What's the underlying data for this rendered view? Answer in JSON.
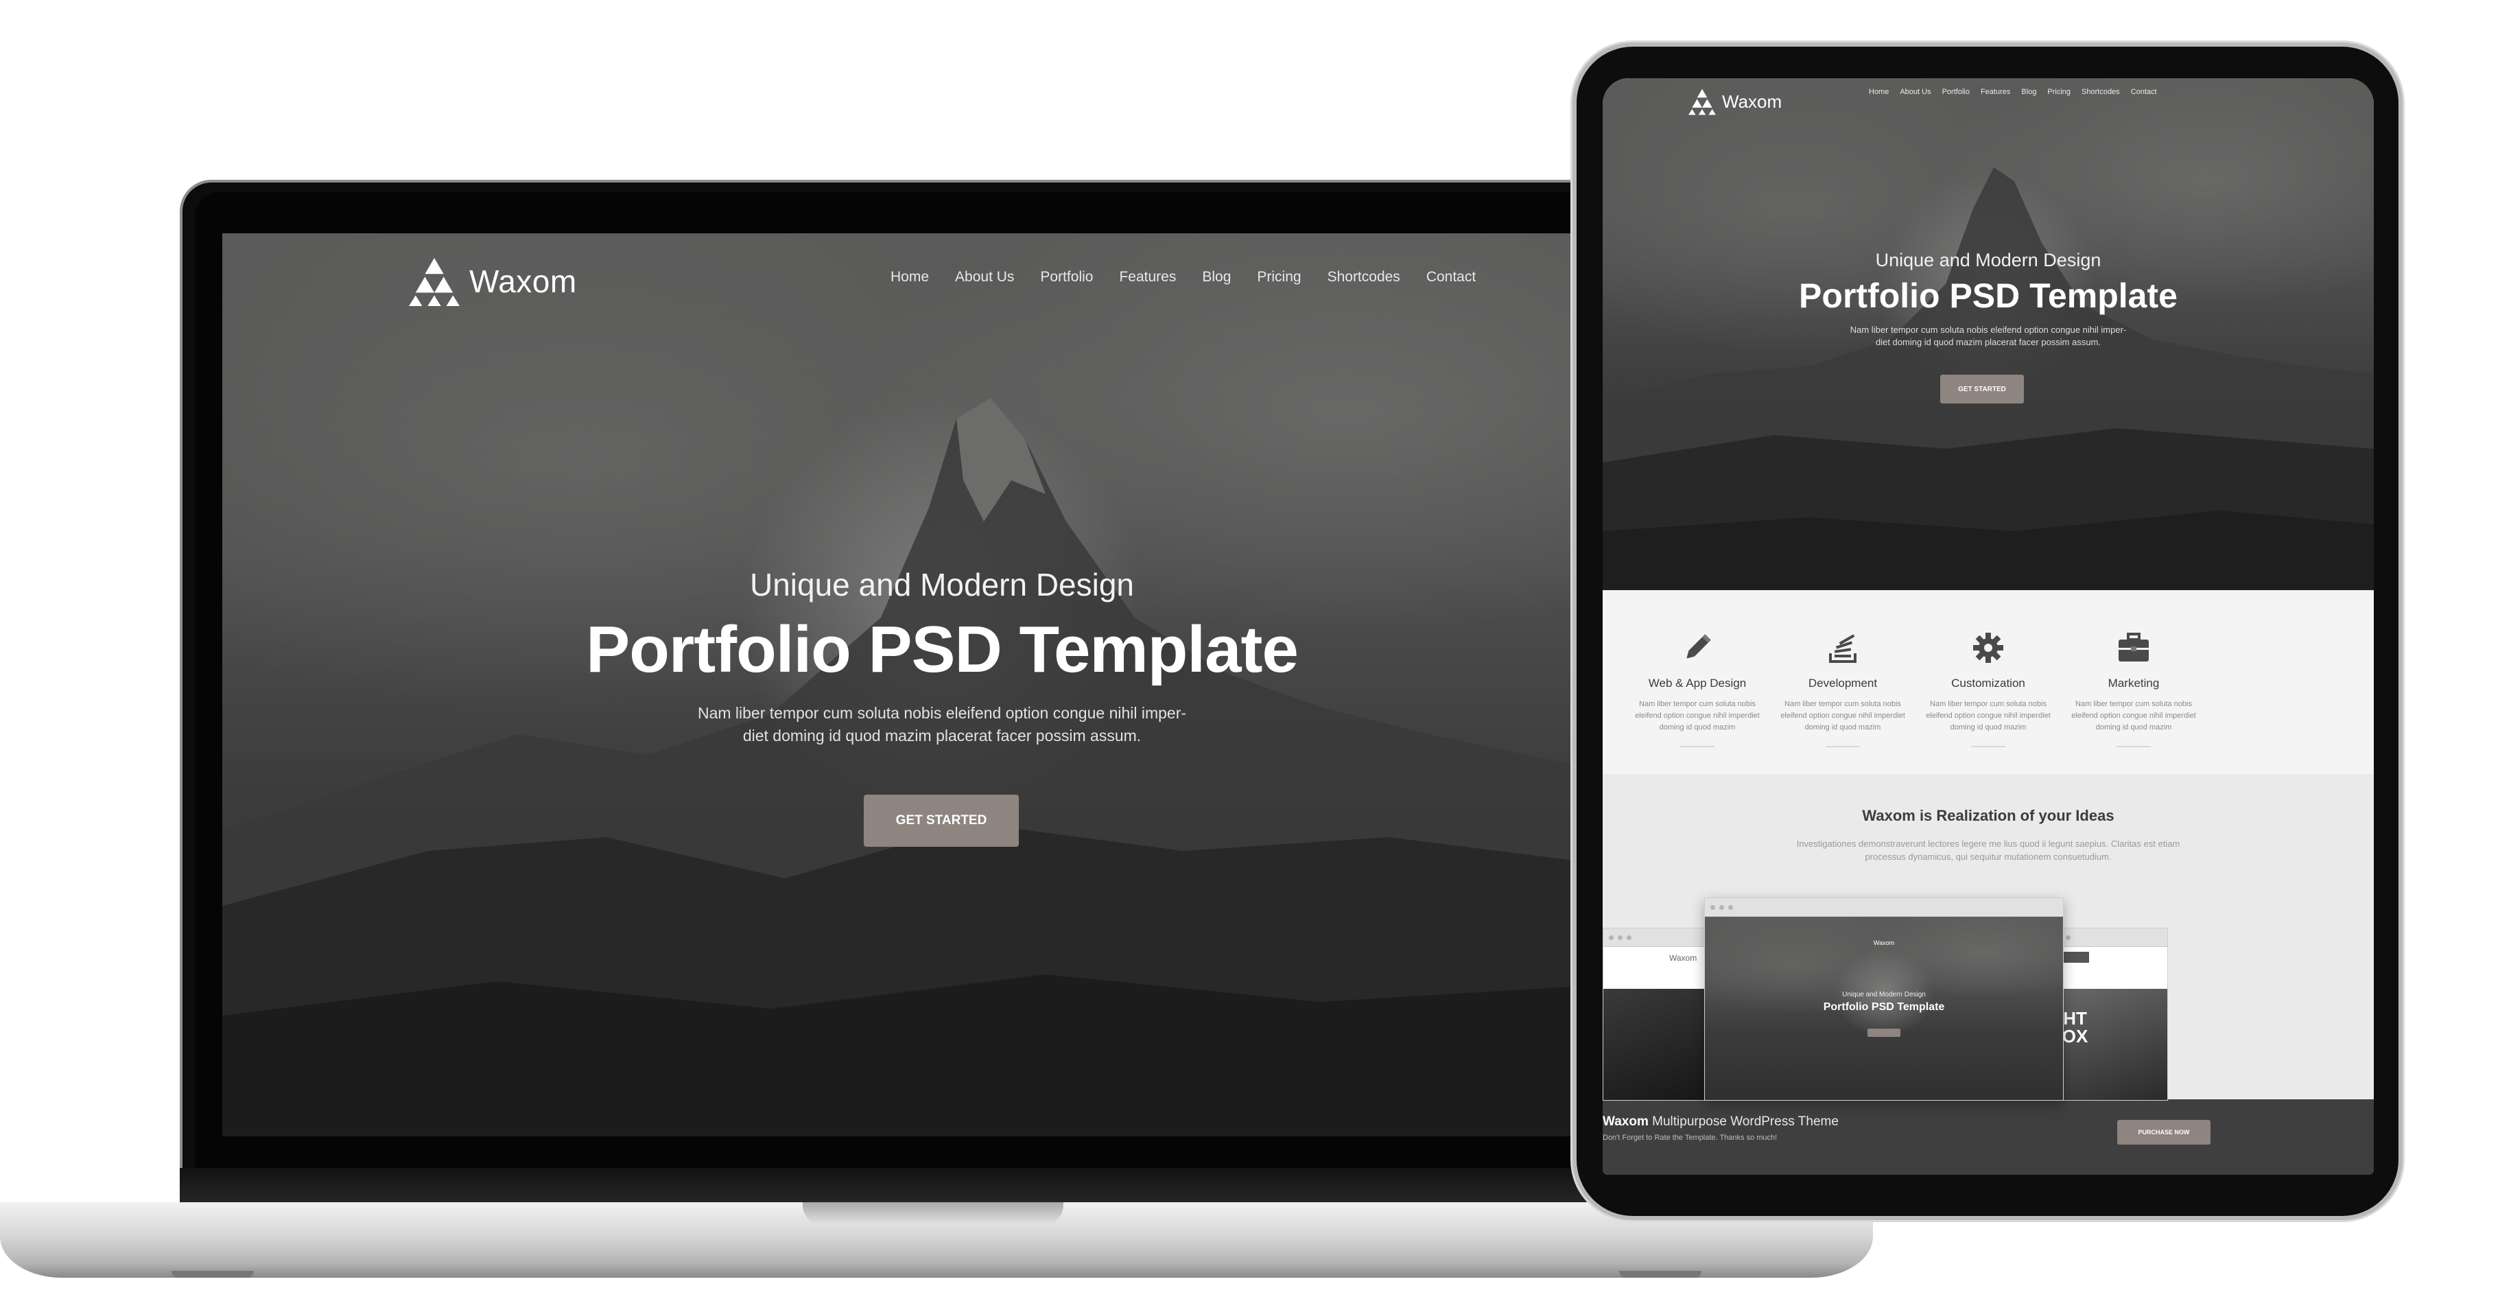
{
  "brand": "Waxom",
  "nav": [
    "Home",
    "About Us",
    "Portfolio",
    "Features",
    "Blog",
    "Pricing",
    "Shortcodes",
    "Contact"
  ],
  "hero": {
    "subtitle": "Unique and Modern Design",
    "title": "Portfolio PSD Template",
    "desc_line1": "Nam liber tempor cum soluta nobis eleifend option congue nihil imper-",
    "desc_line2": "diet doming id quod mazim placerat facer possim assum.",
    "button": "GET STARTED"
  },
  "features": [
    {
      "icon": "pencil-icon",
      "title": "Web & App Design",
      "desc": "Nam liber tempor cum soluta nobis eleifend option congue nihil imperdiet doming id quod mazim"
    },
    {
      "icon": "stack-icon",
      "title": "Development",
      "desc": "Nam liber tempor cum soluta nobis eleifend option congue nihil imperdiet doming id quod mazim"
    },
    {
      "icon": "gear-icon",
      "title": "Customization",
      "desc": "Nam liber tempor cum soluta nobis eleifend option congue nihil imperdiet doming id quod mazim"
    },
    {
      "icon": "briefcase-icon",
      "title": "Marketing",
      "desc": "Nam liber tempor cum soluta nobis eleifend option congue nihil imperdiet doming id quod mazim"
    }
  ],
  "ideas": {
    "title": "Waxom is Realization of your Ideas",
    "desc_line1": "Investigationes demonstraverunt lectores legere me lius quod ii legunt saepius. Claritas est etiam",
    "desc_line2": "processus dynamicus, qui sequitur mutationem consuetudium."
  },
  "footer": {
    "title_brand": "Waxom",
    "title_rest": "Multipurpose WordPress Theme",
    "subtitle": "Don't Forget to Rate the Template. Thanks so much!",
    "button": "PURCHASE NOW"
  },
  "mock_right_text": "GHT\nBOX",
  "colors": {
    "button": "#8e8480",
    "hero_dark": "#3c3c3c",
    "footer": "#3f3f3f"
  }
}
